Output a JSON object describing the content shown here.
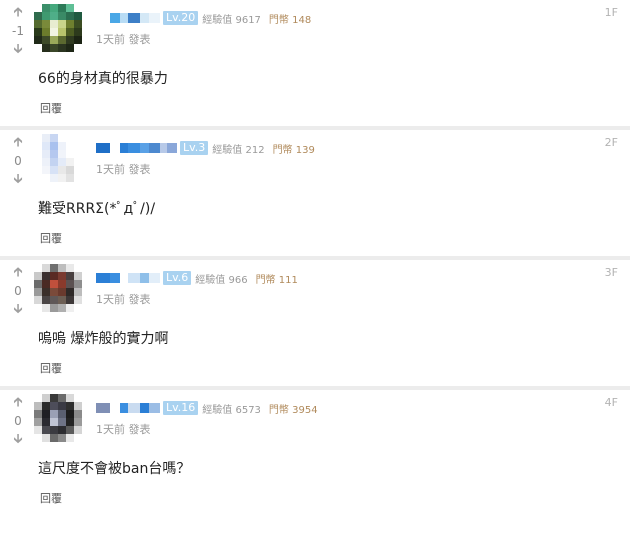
{
  "comments": [
    {
      "floor": "1F",
      "score": "-1",
      "level": "Lv.20",
      "exp_label": "經驗值",
      "exp_value": "9617",
      "coin_label": "門幣",
      "coin_value": "148",
      "time": "1天前 發表",
      "content": "66的身材真的很暴力",
      "reply_label": "回覆",
      "name_colors": [
        "#ffffff",
        "#4aa7e6",
        "#b8dcf5",
        "#3d7fc7",
        "#d4e8f6",
        "#eaf3fa"
      ],
      "avatar_colors": [
        "#ffffff",
        "#3b8f6a",
        "#45a87d",
        "#2d7a58",
        "#5fbf96",
        "#ffffff",
        "#2f6b4d",
        "#3f9a70",
        "#4fae88",
        "#3a8a66",
        "#2b6e50",
        "#1f5a40",
        "#556b2f",
        "#7a8a3a",
        "#e8ecd0",
        "#c9d48a",
        "#6f7f2f",
        "#3c4d22",
        "#2a3a1a",
        "#6c7c2c",
        "#f2f4e2",
        "#b9c46d",
        "#4c5c22",
        "#2d3a1c",
        "#202a18",
        "#3d4a28",
        "#9aa85a",
        "#5b6930",
        "#2f3a20",
        "#1c2414",
        "#ffffff",
        "#262f1c",
        "#3a4628",
        "#2b3520",
        "#1e2716",
        "#ffffff"
      ]
    },
    {
      "floor": "2F",
      "score": "0",
      "level": "Lv.3",
      "exp_label": "經驗值",
      "exp_value": "212",
      "coin_label": "門幣",
      "coin_value": "139",
      "time": "1天前 發表",
      "content": "難受RRRΣ(*ﾟдﾟ/)/",
      "reply_label": "回覆",
      "name_colors": [
        "#1f6fc7",
        "#ffffff",
        "#2b7fd6",
        "#3a8ee0",
        "#5aa1e6",
        "#4d89cf",
        "#b7c9e8",
        "#8aa7d9"
      ],
      "avatar_colors": [
        "#ffffff",
        "#e9eef7",
        "#c8d6f2",
        "#ffffff",
        "#ffffff",
        "#ffffff",
        "#ffffff",
        "#dfe8f8",
        "#a9c1ee",
        "#eef2fa",
        "#ffffff",
        "#ffffff",
        "#ffffff",
        "#e6ecf8",
        "#b5c8ef",
        "#f1f4fa",
        "#ffffff",
        "#ffffff",
        "#ffffff",
        "#edf1f9",
        "#c3d3f1",
        "#e4ebf8",
        "#f2f2f2",
        "#ffffff",
        "#ffffff",
        "#f3f5fa",
        "#d7e2f6",
        "#e8e8e8",
        "#d9d9d9",
        "#ffffff",
        "#ffffff",
        "#ffffff",
        "#eef2f9",
        "#f1f1f1",
        "#e2e2e2",
        "#ffffff"
      ]
    },
    {
      "floor": "3F",
      "score": "0",
      "level": "Lv.6",
      "exp_label": "經驗值",
      "exp_value": "966",
      "coin_label": "門幣",
      "coin_value": "111",
      "time": "1天前 發表",
      "content": "嗚嗚 爆炸般的實力啊",
      "reply_label": "回覆",
      "name_colors": [
        "#2b7fd6",
        "#3a8ee0",
        "#ffffff",
        "#cfe3f6",
        "#8fbfe9",
        "#e2eef9"
      ],
      "avatar_colors": [
        "#ffffff",
        "#d9d9d9",
        "#6f6f6f",
        "#bdbdbd",
        "#e9e9e9",
        "#ffffff",
        "#c9c9c9",
        "#3b3030",
        "#5a2a24",
        "#7a3a30",
        "#494040",
        "#d0d0d0",
        "#6b6b6b",
        "#4a2a24",
        "#c0503c",
        "#8a3a2c",
        "#5b5151",
        "#8e8e8e",
        "#9a9a9a",
        "#3a2f2a",
        "#7a4a3a",
        "#6a3a2e",
        "#2f2a28",
        "#bcbcbc",
        "#d8d8d8",
        "#4a4545",
        "#5f5858",
        "#6d5f55",
        "#3e3838",
        "#e0e0e0",
        "#ffffff",
        "#e7e7e7",
        "#9a9a9a",
        "#b0b0b0",
        "#efefef",
        "#ffffff"
      ]
    },
    {
      "floor": "4F",
      "score": "0",
      "level": "Lv.16",
      "exp_label": "經驗值",
      "exp_value": "6573",
      "coin_label": "門幣",
      "coin_value": "3954",
      "time": "1天前 發表",
      "content": "這尺度不會被ban台嗎？",
      "reply_label": "回覆",
      "name_colors": [
        "#7f8fb5",
        "#ffffff",
        "#3a8ee0",
        "#c9dbf0",
        "#2b7fd6",
        "#9bbde5"
      ],
      "avatar_colors": [
        "#ffffff",
        "#cfcfcf",
        "#3a3a3a",
        "#6b6b6b",
        "#d9d9d9",
        "#ffffff",
        "#bdbdbd",
        "#2a2a2a",
        "#4d4d5a",
        "#3a3a44",
        "#2f2f2f",
        "#cfcfcf",
        "#7a7a7a",
        "#1f1f24",
        "#9aa0b5",
        "#5a5f70",
        "#1c1c1c",
        "#8a8a8a",
        "#a0a0a0",
        "#2a2a30",
        "#bfc4d4",
        "#6e7386",
        "#232323",
        "#9a9a9a",
        "#e5e5e5",
        "#4a4a50",
        "#3a3a40",
        "#2c2c30",
        "#5b5b5b",
        "#d5d5d5",
        "#ffffff",
        "#e0e0e0",
        "#6a6a6a",
        "#8a8a8a",
        "#e8e8e8",
        "#ffffff"
      ]
    }
  ]
}
